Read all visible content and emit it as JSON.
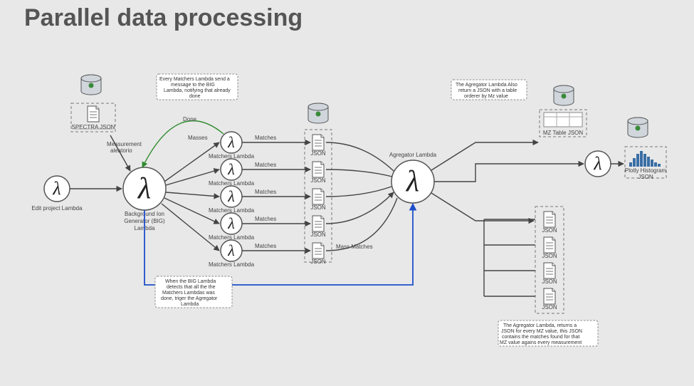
{
  "title": "Parallel data processing",
  "nodes": {
    "edit_project": "Edit project Lambda",
    "big": [
      "Background Ion",
      "Generator (BIG)",
      "Lambda"
    ],
    "matcher": "Matchers Lambda",
    "agregator": "Agregator Lambda",
    "spectra_json": "SPECTRA JSON",
    "mz_table": "MZ Table JSON",
    "plotly": [
      "Plotly Histogram",
      "JSON"
    ],
    "json": "JSON"
  },
  "edges": {
    "matches": "Matches",
    "done": "Done",
    "masses": "Masses",
    "mass_matches": "Mass Matches",
    "measurement": [
      "Measurement",
      "aleatorio"
    ]
  },
  "callouts": {
    "every_matcher": [
      "Every Matchers Lambda send a",
      "message to the BIG",
      "Lambda, notifying that already",
      "done"
    ],
    "when_big": [
      "When the BIG Lambda",
      "detects that all the the",
      "Matchers Lambdas was",
      "done, triger the Agregator",
      "Lambda"
    ],
    "agregator_table": [
      "The Agregator Lambda Also",
      "return a JSON with a table",
      "orderer by Mz value"
    ],
    "agregator_jsons": [
      "The Agregator Lambda, returns a",
      "JSON for every MZ value, this JSON",
      "contains the matches found for that",
      "MZ value agains every measurement"
    ]
  }
}
